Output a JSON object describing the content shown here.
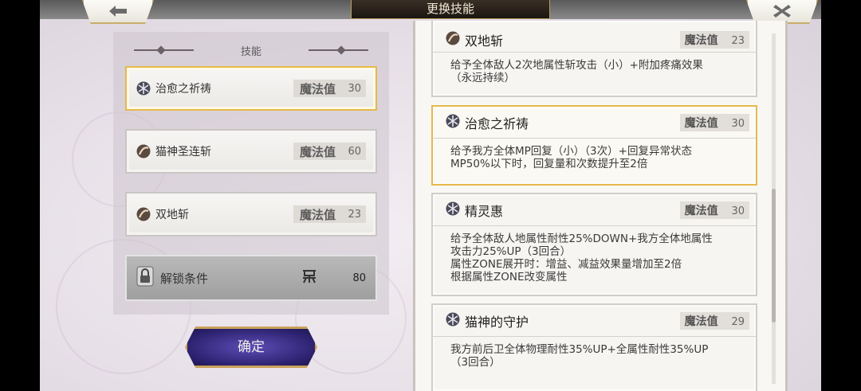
{
  "header": {
    "title": "更换技能",
    "back_icon": "arrow-left-icon",
    "close_icon": "close-icon"
  },
  "left_panel": {
    "heading": "技能",
    "slots": [
      {
        "name": "治愈之祈祷",
        "icon": "snowflake-icon",
        "mp_label": "魔法值",
        "mp": "30",
        "selected": true
      },
      {
        "name": "猫神圣连斩",
        "icon": "slash-orb-icon",
        "mp_label": "魔法值",
        "mp": "60",
        "selected": false
      },
      {
        "name": "双地斩",
        "icon": "slash-orb-icon",
        "mp_label": "魔法值",
        "mp": "23",
        "selected": false
      }
    ],
    "locked": {
      "label": "解锁条件",
      "icon": "padlock-icon",
      "cost_icon": "soul-glyph-icon",
      "cost": "80"
    }
  },
  "confirm": {
    "label": "确定"
  },
  "skill_list": [
    {
      "name": "双地斩",
      "icon": "slash-orb-icon",
      "mp_label": "魔法值",
      "mp": "23",
      "desc": [
        "给予全体敌人2次地属性斩攻击（小）+附加疼痛效果",
        "（永远持续）"
      ]
    },
    {
      "name": "治愈之祈祷",
      "icon": "snowflake-icon",
      "mp_label": "魔法值",
      "mp": "30",
      "selected": true,
      "desc": [
        "给予我方全体MP回复（小）（3次）+回复异常状态",
        "MP50%以下时，回复量和次数提升至2倍"
      ]
    },
    {
      "name": "精灵惠",
      "icon": "snowflake-icon",
      "mp_label": "魔法值",
      "mp": "30",
      "desc": [
        "给予全体敌人地属性耐性25%DOWN+我方全体地属性",
        "攻击力25%UP（3回合）",
        "属性ZONE展开时：增益、减益效果量增加至2倍",
        "根据属性ZONE改变属性"
      ]
    },
    {
      "name": "猫神的守护",
      "icon": "snowflake-icon",
      "mp_label": "魔法值",
      "mp": "29",
      "desc": [
        "我方前后卫全体物理耐性35%UP+全属性耐性35%UP",
        "（3回合）"
      ]
    }
  ],
  "colors": {
    "accent_gold": "#e6b94a",
    "confirm_purple": "#3b2f92"
  }
}
